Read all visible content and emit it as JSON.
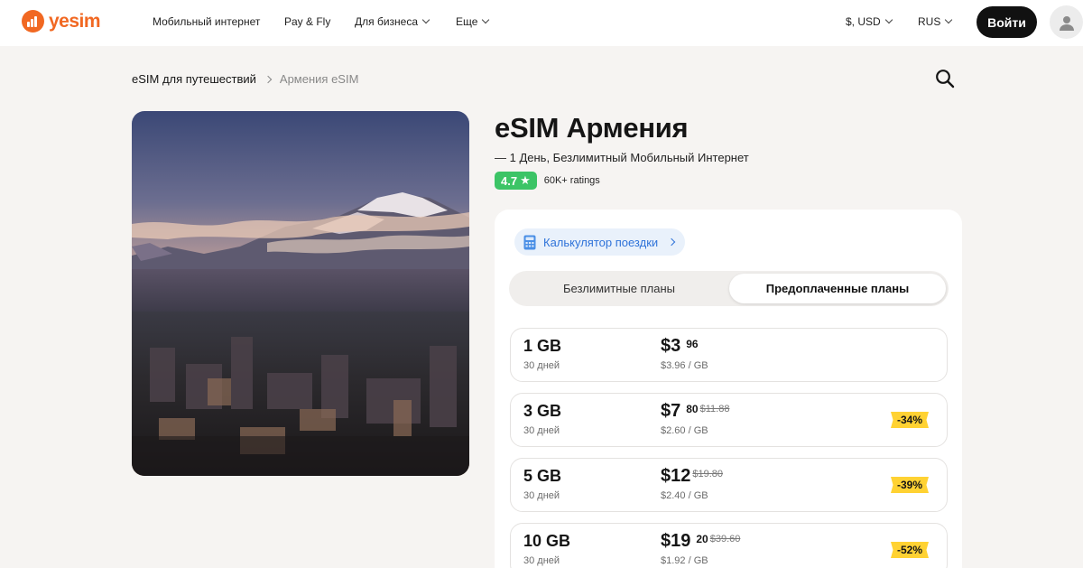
{
  "header": {
    "logo_text": "yesim",
    "nav": {
      "mobile_internet": "Мобильный интернет",
      "pay_fly": "Pay & Fly",
      "business": "Для бизнеса",
      "more": "Еще"
    },
    "currency": "$, USD",
    "language": "RUS",
    "login_label": "Войти"
  },
  "breadcrumb": {
    "parent": "eSIM для путешествий",
    "current": "Армения eSIM"
  },
  "product": {
    "title": "eSIM Армения",
    "subtitle": "— 1 День, Безлимитный Мобильный Интернет",
    "rating": "4.7",
    "ratings_count": "60K+ ratings"
  },
  "plans_card": {
    "calculator_label": "Калькулятор поездки",
    "tabs": {
      "unlimited": "Безлимитные планы",
      "prepaid": "Предоплаченные планы"
    },
    "active_tab": "prepaid",
    "plans": [
      {
        "size": "1 GB",
        "days": "30 дней",
        "price": "$3",
        "cents": "96",
        "old_price": "",
        "per_gb": "$3.96 / GB",
        "discount": ""
      },
      {
        "size": "3 GB",
        "days": "30 дней",
        "price": "$7",
        "cents": "80",
        "old_price": "$11.88",
        "per_gb": "$2.60 / GB",
        "discount": "-34%"
      },
      {
        "size": "5 GB",
        "days": "30 дней",
        "price": "$12",
        "cents": "",
        "old_price": "$19.80",
        "per_gb": "$2.40 / GB",
        "discount": "-39%"
      },
      {
        "size": "10 GB",
        "days": "30 дней",
        "price": "$19",
        "cents": "20",
        "old_price": "$39.60",
        "per_gb": "$1.92 / GB",
        "discount": "-52%"
      }
    ]
  },
  "colors": {
    "brand_orange": "#f16822",
    "rating_green": "#3cc466",
    "link_blue": "#2f73d9",
    "discount_yellow": "#ffd233",
    "page_bg": "#f6f4f2"
  },
  "icons": [
    "yesim-logo-icon",
    "chevron-down-icon",
    "user-icon",
    "chevron-right-icon",
    "search-icon",
    "star-icon",
    "calculator-icon"
  ]
}
